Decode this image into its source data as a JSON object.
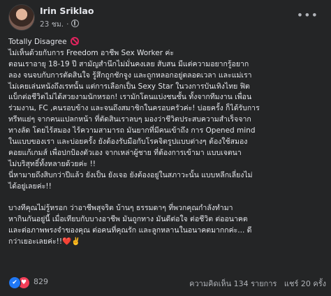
{
  "post": {
    "author": "Irin Sriklao",
    "time": "23 ชม.",
    "lines": [
      "Totally Disagree",
      "ไม่เห็นด้วยกับการ Freedom อาชีพ Sex Worker ค่ะ",
      "ตอนเราอายุ 18-19 ปี สามัญสำนึกไม่มั่นคงเลย สับสน มีแต่ความอยากรู้อยาก",
      "ลอง จนจบกับการตัดสินใจ รู้สึกถูกชักจูง และถูกหลอกอยู่ตลอดเวลา และแม่เรา",
      "ไม่เคยเล่นหนังถึงเรทนั้น แต่การเลือกเป็น Sexy Star ในวงการบันเทิงไทย ฟิต",
      "แบ็กต่อชีวิตไม่ได้สวยงามนักหรอก! เรามักโดนแบ่งชนชั้น ทั้งจากทีมงาน เพื่อน",
      "ร่วมงาน, FC ,คนรอบข้าง และจนถึงสมาชิกในครอบครัวค่ะ! บ่อยครั้ง ก็ได้รับการ",
      "ทรีทแย่ๆ จากคนแปลกหน้า ที่ตัดสินเราลบๆ มองว่าชีวิตประสบความสำเร็จจาก",
      "ทางลัด โดยไร้สมอง ไร้ความสามารถ มันยากที่มีคนเข้าถึง การ Opened mind",
      "ในแบบของเรา และบ่อยครั้ง ยังต้องรับมือกับโรคจิตรูปแบบต่างๆ ต้องใช้สมอง",
      "คอยแก้เกมส์  เพื่อปกป้องตัวเอง จากเหล่าผู้ชาย ที่ต้องการเข้ามา แบบเจตนา",
      "ไม่บริสุทธิ์ทั้งหลายด้วยค่ะ !!",
      "นี่หามายถึงสิบกว่าปีแล้ว ยังเป็น ยังเจอ ยังต้องอยู่ในสภาวะนั้น แบบหลีกเลี่ยงไม่",
      "ได้อยู่เลยค่ะ!!",
      "",
      " บางทีคุณไม่รู้หรอก ว่าอาชีพสุจริต บ้านๆ ธรรมดาๆ ที่พวกคุณกำลังทำมา",
      "หากินกันอยู่นี้ เมื่อเทียบกับบางอาชีพ มันถูกทาง มันดีต่อใจ ต่อชีวิต ต่ออนาคต",
      "และต่อภาพพรงจำของคุณ ต่อคนที่คุณรัก และลูกหลานในอนาคตมากกค่ะ... ดี",
      "กว่าเยอะเลยค่ะ!!❤️✌️"
    ]
  },
  "footer": {
    "reaction_count": "829",
    "comments": "ความคิดเห็น 134 รายการ",
    "shares": "แชร์ 20 ครั้ง"
  },
  "icons": {
    "no_entry": "no-entry-icon",
    "like": "like-icon",
    "love": "love-icon",
    "more": "more-options-icon",
    "globe": "globe-icon"
  },
  "colors": {
    "background": "#242526",
    "text": "#e4e6eb",
    "secondary_text": "#b0b3b8",
    "like_blue": "#2078f4",
    "love_red": "#f33e58"
  }
}
